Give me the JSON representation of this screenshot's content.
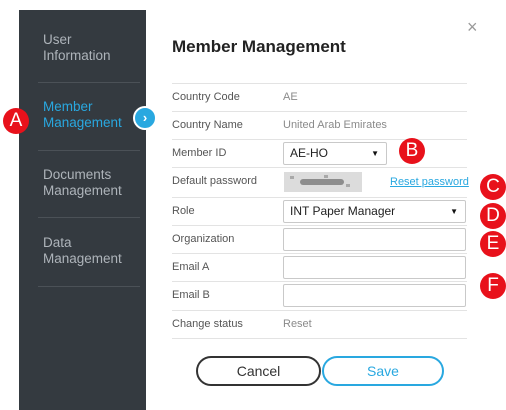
{
  "sidebar": {
    "items": [
      {
        "label": "User Information"
      },
      {
        "label": "Member Management"
      },
      {
        "label": "Documents Management"
      },
      {
        "label": "Data Management"
      }
    ]
  },
  "dialog": {
    "title": "Member Management",
    "close_glyph": "×",
    "expand_glyph": "›"
  },
  "markers": [
    "A",
    "B",
    "C",
    "D",
    "E",
    "F"
  ],
  "form": {
    "country_code": {
      "label": "Country Code",
      "value": "AE"
    },
    "country_name": {
      "label": "Country Name",
      "value": "United Arab Emirates"
    },
    "member_id": {
      "label": "Member ID",
      "selected": "AE-HO"
    },
    "default_password": {
      "label": "Default password",
      "link": "Reset password"
    },
    "role": {
      "label": "Role",
      "selected": "INT Paper Manager"
    },
    "organization": {
      "label": "Organization",
      "value": ""
    },
    "email_a": {
      "label": "Email A",
      "value": ""
    },
    "email_b": {
      "label": "Email B",
      "value": ""
    },
    "change_status": {
      "label": "Change status",
      "value": "Reset"
    }
  },
  "buttons": {
    "cancel": "Cancel",
    "save": "Save"
  },
  "colors": {
    "sidebar_bg": "#343a40",
    "accent": "#29a8e0",
    "marker": "#e8111b"
  }
}
